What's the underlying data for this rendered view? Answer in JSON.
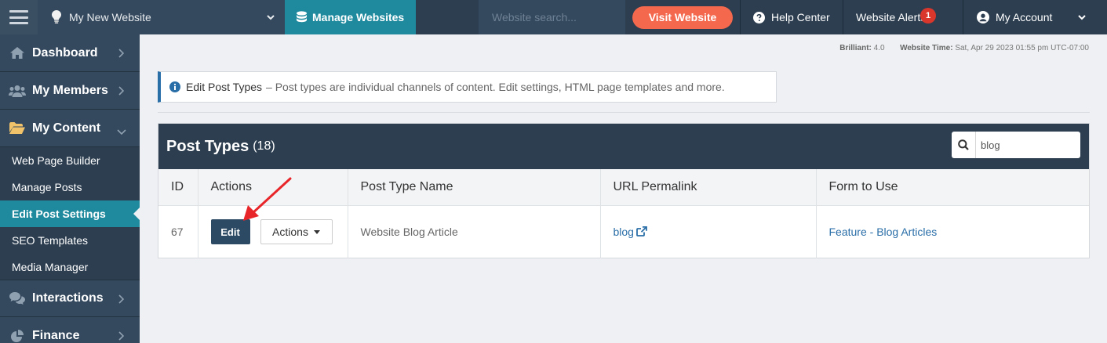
{
  "topbar": {
    "site_name": "My New Website",
    "manage_label": "Manage Websites",
    "search_placeholder": "Website search...",
    "visit_label": "Visit Website",
    "help_label": "Help Center",
    "alerts_label": "Website Alerts",
    "alerts_count": "1",
    "account_label": "My Account"
  },
  "sidebar": {
    "items": [
      {
        "label": "Dashboard",
        "icon": "home-icon"
      },
      {
        "label": "My Members",
        "icon": "users-icon"
      },
      {
        "label": "My Content",
        "icon": "folder-open-icon"
      }
    ],
    "subitems": [
      {
        "label": "Web Page Builder"
      },
      {
        "label": "Manage Posts"
      },
      {
        "label": "Edit Post Settings"
      },
      {
        "label": "SEO Templates"
      },
      {
        "label": "Media Manager"
      }
    ],
    "more": [
      {
        "label": "Interactions",
        "icon": "comments-icon"
      },
      {
        "label": "Finance",
        "icon": "pie-chart-icon"
      }
    ]
  },
  "meta": {
    "brilliant_label": "Brilliant:",
    "brilliant_value": "4.0",
    "time_label": "Website Time:",
    "time_value": "Sat, Apr 29 2023 01:55 pm UTC-07:00"
  },
  "info": {
    "title": "Edit Post Types",
    "text": "– Post types are individual channels of content. Edit settings, HTML page templates and more."
  },
  "panel": {
    "title": "Post Types",
    "count": "(18)",
    "search_value": "blog"
  },
  "table": {
    "headers": [
      "ID",
      "Actions",
      "Post Type Name",
      "URL Permalink",
      "Form to Use"
    ],
    "rows": [
      {
        "id": "67",
        "edit_label": "Edit",
        "actions_label": "Actions",
        "name": "Website Blog Article",
        "permalink": "blog",
        "form": "Feature - Blog Articles"
      }
    ]
  },
  "colors": {
    "topbar": "#2c3e50",
    "accent_teal": "#1f8a9e",
    "visit_orange": "#f4694d",
    "link_blue": "#2a6ea8",
    "alert_red": "#d9362c",
    "annotation_arrow": "#e8262a"
  }
}
